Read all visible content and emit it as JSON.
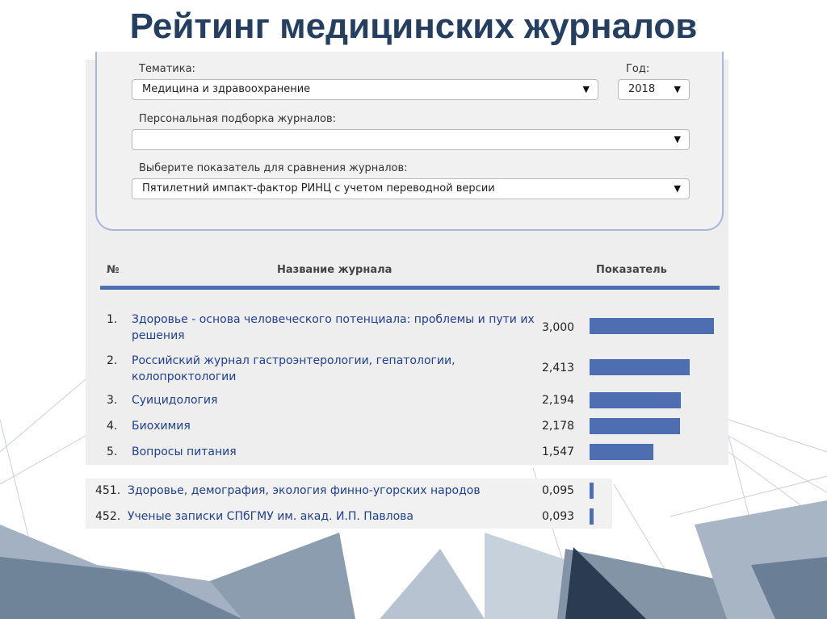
{
  "slide": {
    "title": "Рейтинг медицинских журналов"
  },
  "filters": {
    "topic_label": "Тематика:",
    "topic_value": "Медицина и здравоохранение",
    "year_label": "Год:",
    "year_value": "2018",
    "personal_label": "Персональная подборка журналов:",
    "personal_value": "",
    "indicator_label": "Выберите показатель для сравнения журналов:",
    "indicator_value": "Пятилетний импакт-фактор РИНЦ с учетом переводной версии",
    "dropdown_icon": "▼"
  },
  "table": {
    "headers": {
      "num": "№",
      "name": "Название журнала",
      "value": "Показатель"
    },
    "rows": [
      {
        "num": "1.",
        "name": "Здоровье - основа человеческого потенциала: проблемы и пути их решения",
        "value": "3,000",
        "score": 3.0
      },
      {
        "num": "2.",
        "name": "Российский журнал гастроэнтерологии, гепатологии, колопроктологии",
        "value": "2,413",
        "score": 2.413
      },
      {
        "num": "3.",
        "name": "Суицидология",
        "value": "2,194",
        "score": 2.194
      },
      {
        "num": "4.",
        "name": "Биохимия",
        "value": "2,178",
        "score": 2.178
      },
      {
        "num": "5.",
        "name": "Вопросы питания",
        "value": "1,547",
        "score": 1.547
      }
    ],
    "tail_rows": [
      {
        "num": "451.",
        "name": "Здоровье, демография, экология финно-угорских народов",
        "value": "0,095",
        "score": 0.095
      },
      {
        "num": "452.",
        "name": "Ученые записки СПбГМУ им. акад. И.П. Павлова",
        "value": "0,093",
        "score": 0.093
      }
    ]
  },
  "colors": {
    "title": "#243f60",
    "bar": "#4d6fb2",
    "link": "#1f3f8f",
    "panel_border": "#a9b6d8"
  }
}
